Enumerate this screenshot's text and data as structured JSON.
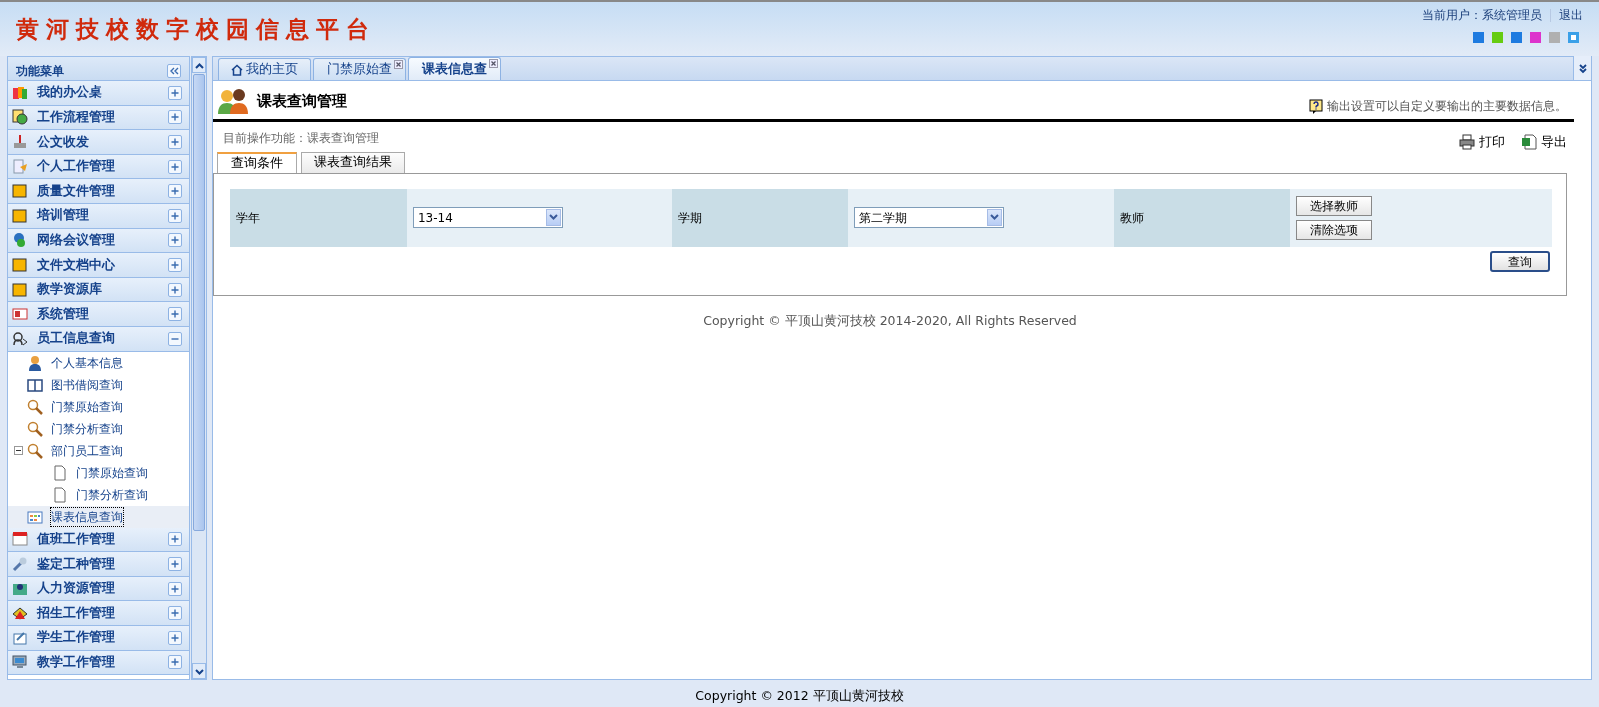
{
  "header": {
    "title": "黄河技校数字校园信息平台",
    "user_label": "当前用户：系统管理员",
    "logout": "退出",
    "theme_swatches": [
      {
        "color": "#1e7be0"
      },
      {
        "color": "#66cc11"
      },
      {
        "color": "#1e7be0"
      },
      {
        "color": "#dd33cc"
      },
      {
        "color": "#b0b0b0"
      },
      {
        "color": "#3aa0e8"
      }
    ]
  },
  "sidebar": {
    "title": "功能菜单",
    "items": [
      {
        "label": "我的办公桌",
        "expanded": false
      },
      {
        "label": "工作流程管理",
        "expanded": false
      },
      {
        "label": "公文收发",
        "expanded": false
      },
      {
        "label": "个人工作管理",
        "expanded": false
      },
      {
        "label": "质量文件管理",
        "expanded": false
      },
      {
        "label": "培训管理",
        "expanded": false
      },
      {
        "label": "网络会议管理",
        "expanded": false
      },
      {
        "label": "文件文档中心",
        "expanded": false
      },
      {
        "label": "教学资源库",
        "expanded": false
      },
      {
        "label": "系统管理",
        "expanded": false
      },
      {
        "label": "员工信息查询",
        "expanded": true,
        "children": [
          {
            "label": "个人基本信息",
            "selected": false
          },
          {
            "label": "图书借阅查询",
            "selected": false
          },
          {
            "label": "门禁原始查询",
            "selected": false
          },
          {
            "label": "门禁分析查询",
            "selected": false
          },
          {
            "label": "部门员工查询",
            "selected": false,
            "expanded": true,
            "children": [
              {
                "label": "门禁原始查询",
                "selected": false
              },
              {
                "label": "门禁分析查询",
                "selected": false
              }
            ]
          },
          {
            "label": "课表信息查询",
            "selected": true
          }
        ]
      },
      {
        "label": "值班工作管理",
        "expanded": false
      },
      {
        "label": "鉴定工种管理",
        "expanded": false
      },
      {
        "label": "人力资源管理",
        "expanded": false
      },
      {
        "label": "招生工作管理",
        "expanded": false
      },
      {
        "label": "学生工作管理",
        "expanded": false
      },
      {
        "label": "教学工作管理",
        "expanded": false
      }
    ]
  },
  "tabs": [
    {
      "label": "我的主页",
      "selected": false,
      "closable": false
    },
    {
      "label": "门禁原始查",
      "selected": false,
      "closable": true
    },
    {
      "label": "课表信息查",
      "selected": true,
      "closable": true
    }
  ],
  "page": {
    "title": "课表查询管理",
    "hint": "输出设置可以自定义要输出的主要数据信息。",
    "breadcrumb": "目前操作功能：课表查询管理",
    "actions": [
      {
        "label": "打印",
        "kind": "print"
      },
      {
        "label": "导出",
        "kind": "export"
      }
    ],
    "subtabs": [
      {
        "label": "查询条件",
        "selected": true
      },
      {
        "label": "课表查询结果",
        "selected": false
      }
    ],
    "fields": [
      {
        "label": "学年",
        "kind": "select",
        "value": "13-14"
      },
      {
        "label": "学期",
        "kind": "select",
        "value": "第二学期"
      },
      {
        "label": "教师",
        "kind": "buttons",
        "buttons": [
          "选择教师",
          "清除选项"
        ]
      }
    ],
    "query_button": "查询",
    "copyright": "Copyright © 平顶山黄河技校  2014-2020, All Rights Reserved"
  },
  "footer": "Copyright © 2012 平顶山黄河技校"
}
